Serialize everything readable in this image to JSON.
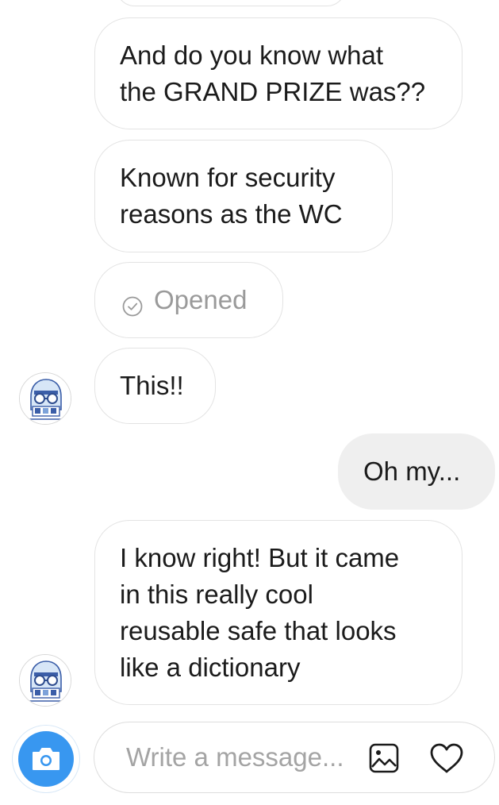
{
  "thread": {
    "messages": [
      {
        "lines": [
          "And do you know what",
          "the GRAND PRIZE was??"
        ]
      },
      {
        "lines": [
          "Known for security",
          "reasons as the WC"
        ]
      },
      {
        "lines": [
          "This!!"
        ]
      },
      {
        "lines": [
          "Oh my..."
        ]
      },
      {
        "lines": [
          "I know right! But it came",
          "in this really cool",
          "reusable safe that looks",
          "like a dictionary"
        ]
      }
    ],
    "opened_label": "Opened"
  },
  "composer": {
    "placeholder": "Write a message..."
  },
  "icons": {
    "camera": "camera-icon",
    "gallery": "image-icon",
    "like": "heart-icon",
    "read_receipt": "check-circle-icon"
  },
  "colors": {
    "accent": "#3897f0",
    "outgoing_bubble": "#efefef",
    "border": "#e3e3e3",
    "muted_text": "#9a9a9a"
  }
}
